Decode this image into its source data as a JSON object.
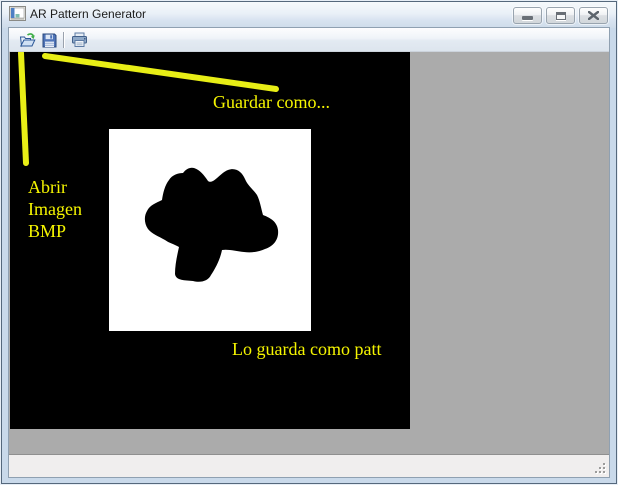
{
  "window": {
    "title": "AR Pattern Generator"
  },
  "window_controls": {
    "icons": [
      "minimize-icon",
      "maximize-icon",
      "close-icon"
    ]
  },
  "toolbar": {
    "icons": [
      "open-folder-icon",
      "save-floppy-icon",
      "print-icon"
    ]
  },
  "annotations": {
    "save_as": "Guardar como...",
    "open_bmp_lines": [
      "Abrir",
      "Imagen",
      "BMP"
    ],
    "save_patt": "Lo guarda como patt"
  },
  "statusbar": {
    "icons": [
      "resize-grip"
    ]
  },
  "colors": {
    "annotation_text": "#f5f500",
    "annotation_line": "#e8ee16",
    "canvas_background": "#000000",
    "workspace_background": "#ababab",
    "pattern_square": "#ffffff",
    "frame": "#c9d9ea"
  }
}
